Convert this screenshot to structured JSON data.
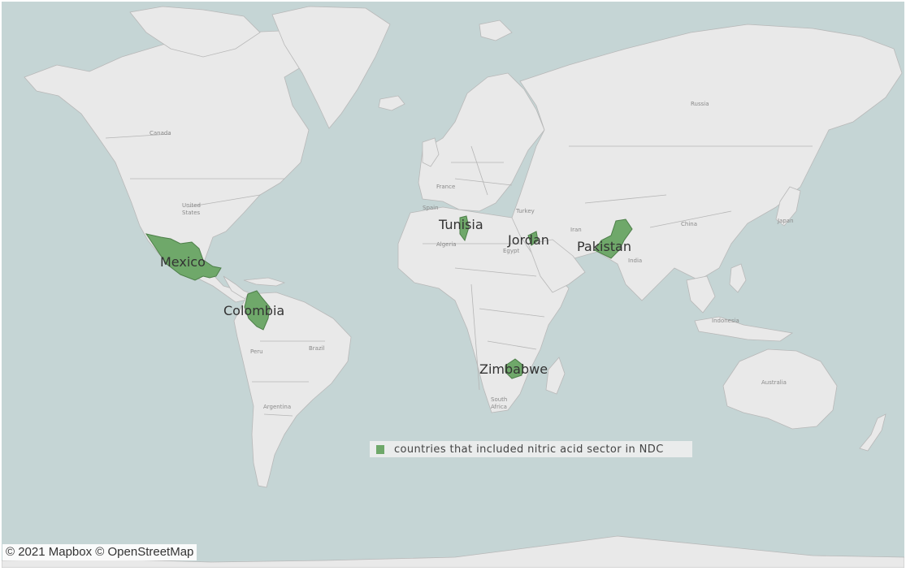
{
  "map": {
    "small_labels": {
      "canada": "Canada",
      "united_states_line1": "United",
      "united_states_line2": "States",
      "brazil": "Brazil",
      "peru": "Peru",
      "argentina": "Argentina",
      "france": "France",
      "spain": "Spain",
      "turkey": "Turkey",
      "algeria": "Algeria",
      "egypt": "Egypt",
      "iran": "Iran",
      "india": "India",
      "russia": "Russia",
      "china": "China",
      "japan": "Japan",
      "indonesia": "Indonesia",
      "australia": "Australia",
      "south_africa_line1": "South",
      "south_africa_line2": "Africa"
    },
    "highlighted": {
      "mexico": "Mexico",
      "colombia": "Colombia",
      "tunisia": "Tunisia",
      "jordan": "Jordan",
      "pakistan": "Pakistan",
      "zimbabwe": "Zimbabwe"
    },
    "colors": {
      "ocean": "#c5d5d5",
      "land": "#e9e9e9",
      "highlight": "#6fa86a"
    }
  },
  "legend": {
    "label": "countries that included nitric acid sector in NDC"
  },
  "attribution": "© 2021 Mapbox © OpenStreetMap"
}
